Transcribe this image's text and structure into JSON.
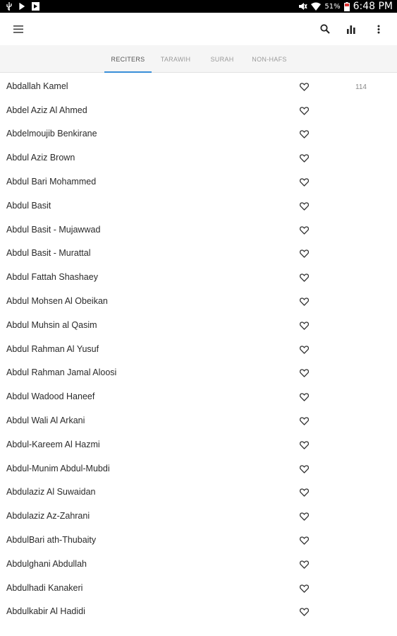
{
  "status_bar": {
    "battery_percent": "51%",
    "time": "6:48 PM"
  },
  "toolbar": {
    "menu_icon": "menu-icon",
    "search_icon": "search-icon",
    "stats_icon": "bar-chart-icon",
    "more_icon": "more-vert-icon"
  },
  "tabs": [
    {
      "label": "RECITERS",
      "active": true
    },
    {
      "label": "TARAWIH",
      "active": false
    },
    {
      "label": "SURAH",
      "active": false
    },
    {
      "label": "NON-HAFS",
      "active": false
    }
  ],
  "reciters": {
    "count_label": "114",
    "items": [
      "Abdallah Kamel",
      "Abdel Aziz Al Ahmed",
      "Abdelmoujib Benkirane",
      "Abdul Aziz Brown",
      "Abdul Bari Mohammed",
      "Abdul Basit",
      "Abdul Basit - Mujawwad",
      "Abdul Basit - Murattal",
      "Abdul Fattah Shashaey",
      "Abdul Mohsen Al Obeikan",
      "Abdul Muhsin al Qasim",
      "Abdul Rahman Al Yusuf",
      "Abdul Rahman Jamal Aloosi",
      "Abdul Wadood Haneef",
      "Abdul Wali Al Arkani",
      "Abdul-Kareem Al Hazmi",
      "Abdul-Munim Abdul-Mubdi",
      "Abdulaziz Al Suwaidan",
      "Abdulaziz Az-Zahrani",
      "AbdulBari ath-Thubaity",
      "Abdulghani Abdullah",
      "Abdulhadi Kanakeri",
      "Abdulkabir Al Hadidi"
    ]
  }
}
